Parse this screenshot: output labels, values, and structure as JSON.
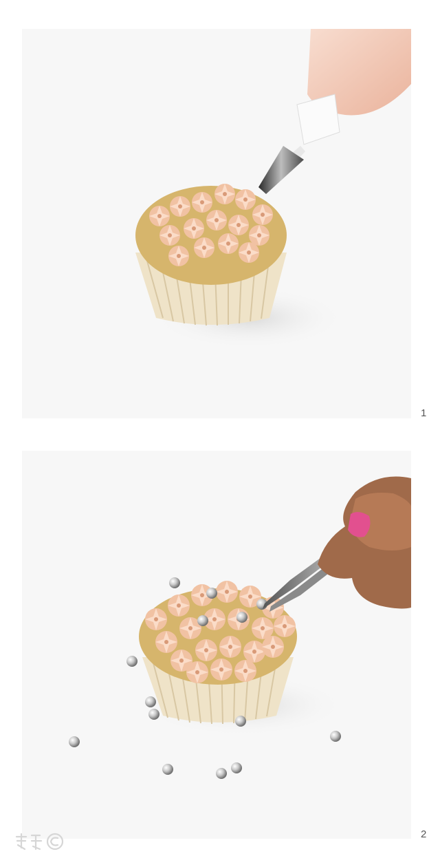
{
  "steps": [
    {
      "number": "1"
    },
    {
      "number": "2"
    }
  ],
  "colors": {
    "background": "#f7f7f7",
    "frosting": "#f4cbb0",
    "frosting_shade": "#d99a78",
    "cake": "#d6b56c",
    "liner": "#efe3c8",
    "piping_bag": "#f3c9b5",
    "coupler": "#fbfbfb",
    "nail_polish": "#e2508f",
    "skin": "#a06a4a",
    "pearl": "#c9c9c9"
  },
  "watermark": {
    "icon": "logo-watermark-icon"
  }
}
